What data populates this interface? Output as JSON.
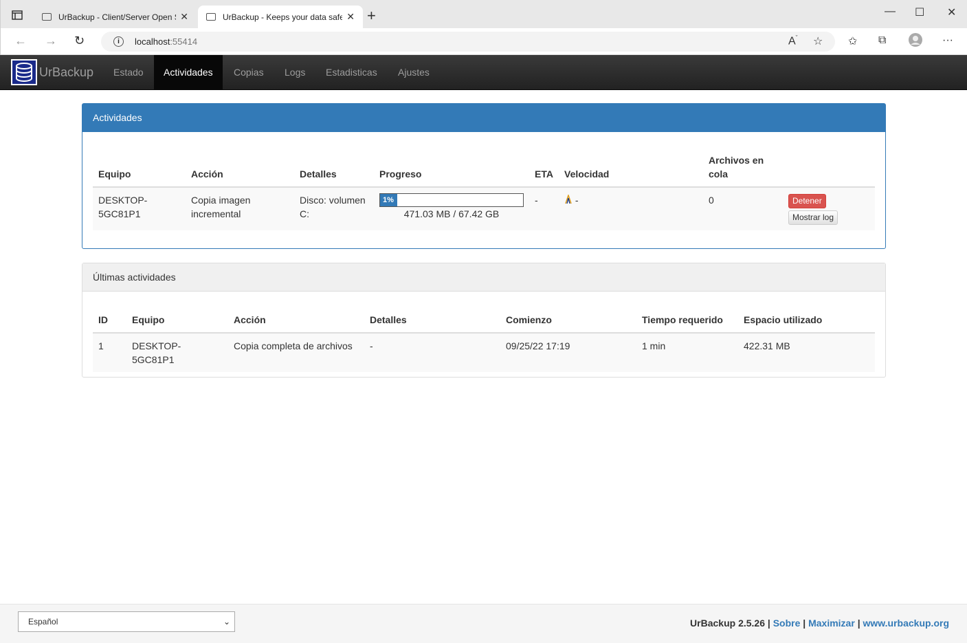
{
  "browser": {
    "tabs": [
      {
        "title": "UrBackup - Client/Server Open S",
        "active": false
      },
      {
        "title": "UrBackup - Keeps your data safe",
        "active": true
      }
    ],
    "url_host": "localhost",
    "url_port": ":55414"
  },
  "navbar": {
    "brand": "UrBackup",
    "items": [
      "Estado",
      "Actividades",
      "Copias",
      "Logs",
      "Estadisticas",
      "Ajustes"
    ],
    "active": "Actividades"
  },
  "activities": {
    "title": "Actividades",
    "headers": [
      "Equipo",
      "Acción",
      "Detalles",
      "Progreso",
      "ETA",
      "Velocidad",
      "Archivos en cola",
      ""
    ],
    "row": {
      "equipo": "DESKTOP-5GC81P1",
      "accion": "Copia imagen incremental",
      "detalles": "Disco: volumen C:",
      "progress_percent": 1,
      "progress_label": "1%",
      "progress_text": "471.03 MB / 67.42 GB",
      "eta": "-",
      "velocidad": "-",
      "archivos_cola": "0",
      "stop_label": "Detener",
      "log_label": "Mostrar log"
    }
  },
  "last_activities": {
    "title": "Últimas actividades",
    "headers": [
      "ID",
      "Equipo",
      "Acción",
      "Detalles",
      "Comienzo",
      "Tiempo requerido",
      "Espacio utilizado"
    ],
    "rows": [
      [
        "1",
        "DESKTOP-5GC81P1",
        "Copia completa de archivos",
        "-",
        "09/25/22 17:19",
        "1 min",
        "422.31 MB"
      ]
    ]
  },
  "footer": {
    "language": "Español",
    "version": "UrBackup 2.5.26",
    "sep": "|",
    "links": [
      "Sobre",
      "Maximizar",
      "www.urbackup.org"
    ]
  },
  "colors": {
    "primary": "#337ab7",
    "danger": "#d9534f",
    "navbar": "#222222"
  }
}
